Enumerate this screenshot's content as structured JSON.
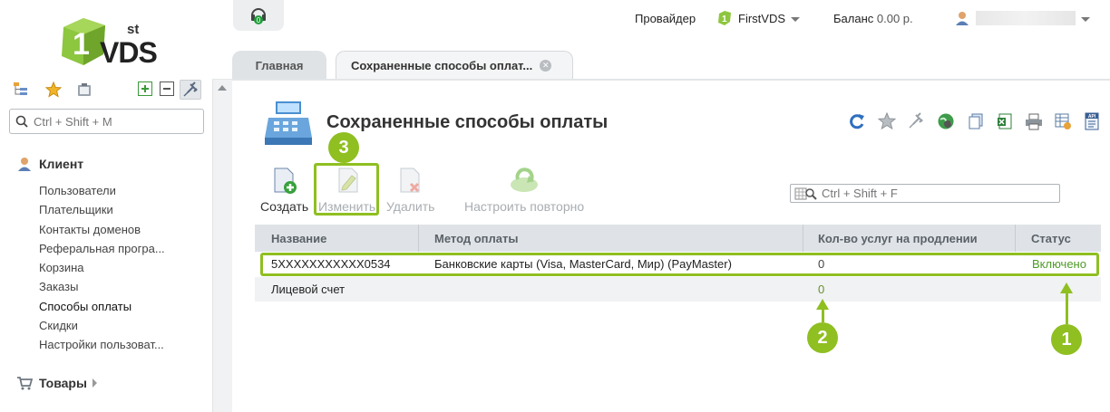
{
  "logo": {
    "superscript": "st",
    "text": "VDS"
  },
  "header": {
    "provider_label": "Провайдер",
    "provider_value": "FirstVDS",
    "balance_label": "Баланс",
    "balance_value": "0.00 р."
  },
  "tabs": [
    {
      "label": "Главная"
    },
    {
      "label": "Сохраненные способы оплат..."
    }
  ],
  "sidebar": {
    "search_placeholder": "Ctrl + Shift + M",
    "client_section": "Клиент",
    "items": [
      {
        "label": "Пользователи"
      },
      {
        "label": "Плательщики"
      },
      {
        "label": "Контакты доменов"
      },
      {
        "label": "Реферальная програ..."
      },
      {
        "label": "Корзина"
      },
      {
        "label": "Заказы"
      },
      {
        "label": "Способы оплаты"
      },
      {
        "label": "Скидки"
      },
      {
        "label": "Настройки пользоват..."
      }
    ],
    "goods_section": "Товары"
  },
  "page": {
    "title": "Сохраненные способы оплаты",
    "actions": {
      "create": "Создать",
      "edit": "Изменить",
      "delete": "Удалить",
      "reconfigure": "Настроить повторно"
    },
    "grid_search_placeholder": "Ctrl + Shift + F",
    "table": {
      "columns": [
        "Название",
        "Метод оплаты",
        "Кол-во услуг на продлении",
        "Статус"
      ],
      "rows": [
        {
          "name": "5XXXXXXXXXXX0534",
          "method": "Банковские карты (Visa, MasterCard, Мир) (PayMaster)",
          "count": "0",
          "status": "Включено"
        },
        {
          "name": "Лицевой счет",
          "method": "",
          "count": "0",
          "status": ""
        }
      ]
    },
    "callouts": {
      "one": "1",
      "two": "2",
      "three": "3"
    }
  },
  "colors": {
    "accent_green": "#8fbf21",
    "status_green": "#4e9a27",
    "header_bg": "#dfe3e7"
  }
}
